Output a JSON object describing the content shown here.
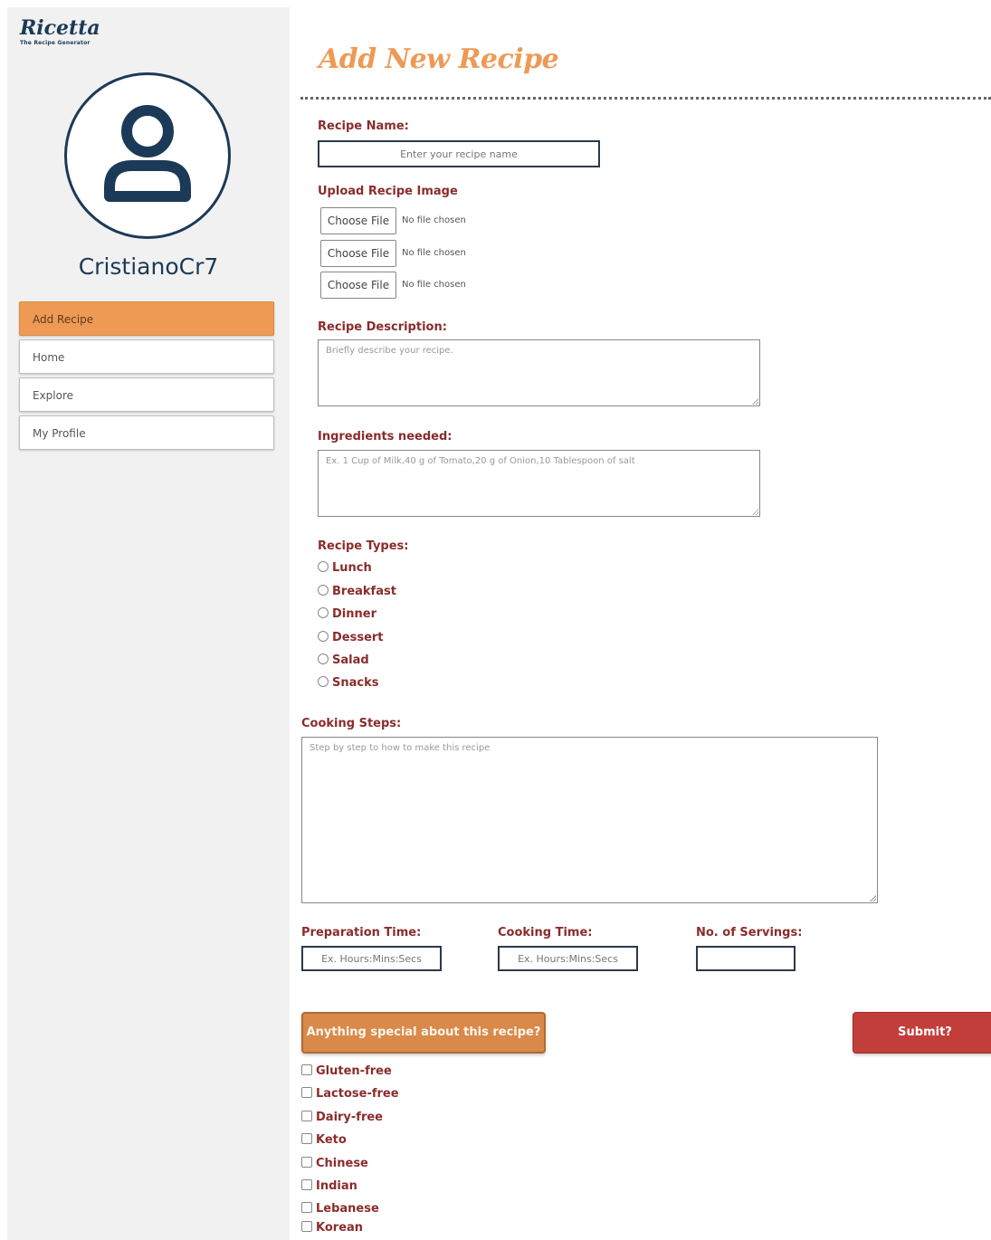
{
  "brand": {
    "name": "Ricetta",
    "tagline": "The Recipe Generator"
  },
  "sidebar": {
    "username": "CristianoCr7",
    "items": [
      {
        "label": "Add Recipe",
        "active": true
      },
      {
        "label": "Home",
        "active": false
      },
      {
        "label": "Explore",
        "active": false
      },
      {
        "label": "My Profile",
        "active": false
      }
    ]
  },
  "form": {
    "title": "Add New Recipe",
    "recipe_name": {
      "label": "Recipe Name:",
      "placeholder": "Enter your recipe name",
      "value": ""
    },
    "upload": {
      "label": "Upload Recipe Image",
      "files": [
        {
          "button": "Choose File",
          "status": "No file chosen"
        },
        {
          "button": "Choose File",
          "status": "No file chosen"
        },
        {
          "button": "Choose File",
          "status": "No file chosen"
        }
      ]
    },
    "description": {
      "label": "Recipe Description:",
      "placeholder": "Briefly describe your recipe."
    },
    "ingredients": {
      "label": "Ingredients needed:",
      "placeholder": "Ex. 1 Cup of Milk,40 g of Tomato,20 g of Onion,10 Tablespoon of salt"
    },
    "types": {
      "label": "Recipe Types:",
      "options": [
        "Lunch",
        "Breakfast",
        "Dinner",
        "Dessert",
        "Salad",
        "Snacks"
      ]
    },
    "cooking_steps": {
      "label": "Cooking Steps:",
      "placeholder": "Step by step to how to make this recipe"
    },
    "prep_time": {
      "label": "Preparation Time:",
      "placeholder": "Ex. Hours:Mins:Secs"
    },
    "cook_time": {
      "label": "Cooking Time:",
      "placeholder": "Ex. Hours:Mins:Secs"
    },
    "servings": {
      "label": "No. of Servings:",
      "value": ""
    },
    "special_button": "Anything special about this recipe?",
    "submit_button": "Submit?",
    "special": {
      "options": [
        "Gluten-free",
        "Lactose-free",
        "Dairy-free",
        "Keto",
        "Chinese",
        "Indian",
        "Lebanese",
        "Korean"
      ]
    }
  },
  "colors": {
    "accent_orange": "#ee9a55",
    "label_red": "#8a2c2c",
    "submit_red": "#c13e3a",
    "navy": "#1b3a57",
    "sidebar_bg": "#f1f1f1"
  }
}
